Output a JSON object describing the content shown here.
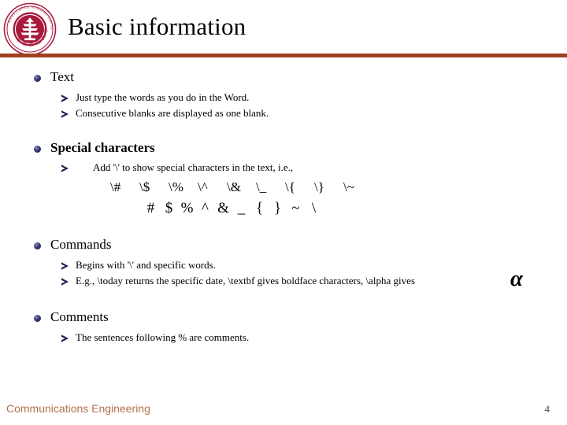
{
  "slide": {
    "title": "Basic information",
    "page_number": "4",
    "accent_rule_color": "#a0401f",
    "logo": {
      "name": "east-china-normal-university-seal",
      "outer_ring_text": "EAST CHINA NORMAL UNIVERSITY",
      "inner_text": "华东师范大学",
      "color": "#a81a3c"
    },
    "footer": {
      "label": "Communications Engineering",
      "color": "#b3724b"
    }
  },
  "sections": [
    {
      "heading": "Text",
      "bold": false,
      "items": [
        "Just type the words as you do in the Word.",
        "Consecutive blanks are displayed as one blank."
      ]
    },
    {
      "heading": "Special characters",
      "bold": true,
      "items": [
        "Add '\\' to show special characters in the text, i.e.,"
      ],
      "special_characters": {
        "escaped": [
          "\\#",
          "\\$",
          "\\%",
          "\\^",
          "\\&",
          "\\_",
          "\\{",
          "\\}",
          "\\~"
        ],
        "rendered": [
          "#",
          "$",
          "%",
          "^",
          "&",
          "_",
          "{",
          "}",
          "~",
          "\\"
        ]
      }
    },
    {
      "heading": "Commands",
      "bold": false,
      "items": [
        "Begins with '\\' and specific words.",
        "E.g., \\today returns the specific date, \\textbf gives boldface characters, \\alpha gives"
      ],
      "trailing_symbol": "α"
    },
    {
      "heading": "Comments",
      "bold": false,
      "items": [
        "The sentences following % are comments."
      ]
    }
  ]
}
